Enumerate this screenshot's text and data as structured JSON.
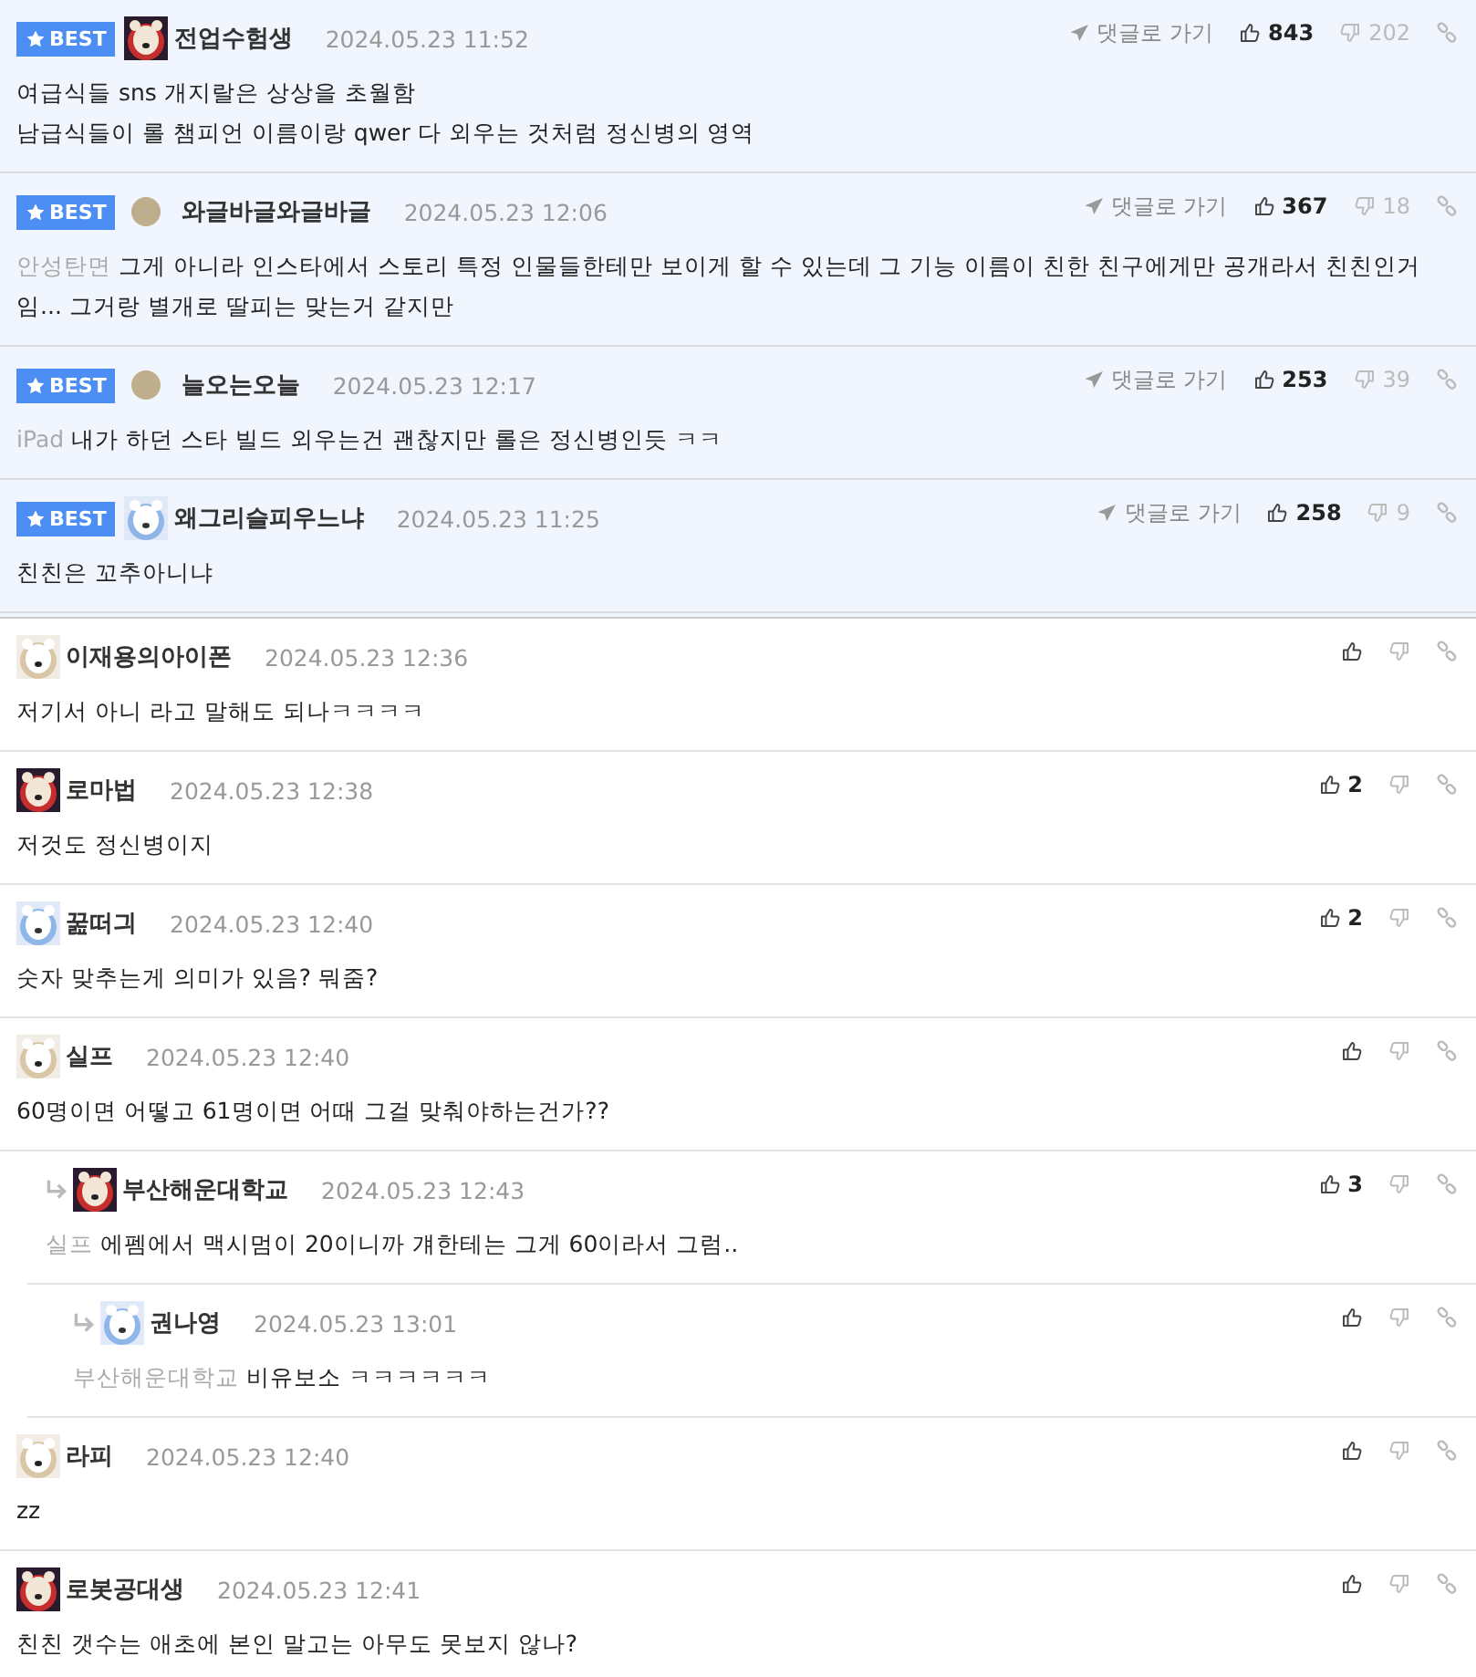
{
  "comments": [
    {
      "best": true,
      "badge": "BEST",
      "avatar": {
        "kind": "picture"
      },
      "name": "전업수험생",
      "date": "2024.05.23 11:52",
      "goto": "댓글로 가기",
      "likes": "843",
      "dislikes": "202",
      "lines": [
        "여급식들 sns 개지랄은 상상을 초월함",
        "남급식들이 롤 챔피언 이름이랑 qwer 다 외우는 것처럼 정신병의 영역"
      ]
    },
    {
      "best": true,
      "badge": "BEST",
      "avatar": {
        "kind": "dot"
      },
      "name": "와글바글와글바글",
      "date": "2024.05.23 12:06",
      "goto": "댓글로 가기",
      "likes": "367",
      "dislikes": "18",
      "prefix": "안성탄면",
      "lines": [
        "그게 아니라 인스타에서 스토리 특정 인물들한테만 보이게 할 수 있는데 그 기능 이름이 친한 친구에게만 공개라서 친친인거임... 그거랑 별개로 딸피는 맞는거 같지만"
      ]
    },
    {
      "best": true,
      "badge": "BEST",
      "avatar": {
        "kind": "dot"
      },
      "name": "늘오는오늘",
      "date": "2024.05.23 12:17",
      "goto": "댓글로 가기",
      "likes": "253",
      "dislikes": "39",
      "prefix": "iPad",
      "lines": [
        "내가 하던 스타 빌드 외우는건 괜찮지만 롤은 정신병인듯 ㅋㅋ"
      ]
    },
    {
      "best": true,
      "badge": "BEST",
      "avatar": {
        "kind": "picture"
      },
      "name": "왜그리슬피우느냐",
      "date": "2024.05.23 11:25",
      "goto": "댓글로 가기",
      "likes": "258",
      "dislikes": "9",
      "lines": [
        "친친은 꼬추아니냐"
      ]
    },
    {
      "best": false,
      "avatar": {
        "kind": "picture"
      },
      "name": "이재용의아이폰",
      "date": "2024.05.23 12:36",
      "lines": [
        "저기서 아니 라고 말해도 되나ㅋㅋㅋㅋ"
      ]
    },
    {
      "best": false,
      "avatar": {
        "kind": "picture"
      },
      "name": "로마법",
      "date": "2024.05.23 12:38",
      "likes": "2",
      "lines": [
        "저것도 정신병이지"
      ]
    },
    {
      "best": false,
      "avatar": {
        "kind": "picture"
      },
      "name": "꿆떠긔",
      "date": "2024.05.23 12:40",
      "likes": "2",
      "lines": [
        "숫자 맞추는게 의미가 있음? 뭐줌?"
      ]
    },
    {
      "best": false,
      "avatar": {
        "kind": "picture"
      },
      "name": "실프",
      "date": "2024.05.23 12:40",
      "lines": [
        "60명이면 어떻고 61명이면 어때 그걸 맞춰야하는건가??"
      ],
      "children": [
        {
          "best": false,
          "avatar": {
            "kind": "picture"
          },
          "name": "부산해운대학교",
          "date": "2024.05.23 12:43",
          "likes": "3",
          "prefix": "실프",
          "lines": [
            "에펨에서 맥시멈이 20이니까 걔한테는 그게 60이라서 그럼.."
          ],
          "children": [
            {
              "best": false,
              "avatar": {
                "kind": "picture"
              },
              "name": "권나영",
              "date": "2024.05.23 13:01",
              "prefix": "부산해운대학교",
              "lines": [
                "비유보소 ㅋㅋㅋㅋㅋㅋ"
              ]
            }
          ]
        }
      ]
    },
    {
      "best": false,
      "avatar": {
        "kind": "picture"
      },
      "name": "라피",
      "date": "2024.05.23 12:40",
      "lines": [
        "zz"
      ]
    },
    {
      "best": false,
      "avatar": {
        "kind": "picture"
      },
      "name": "로봇공대생",
      "date": "2024.05.23 12:41",
      "lines": [
        "친친 갯수는 애초에 본인 말고는 아무도 못보지 않나?"
      ]
    }
  ]
}
